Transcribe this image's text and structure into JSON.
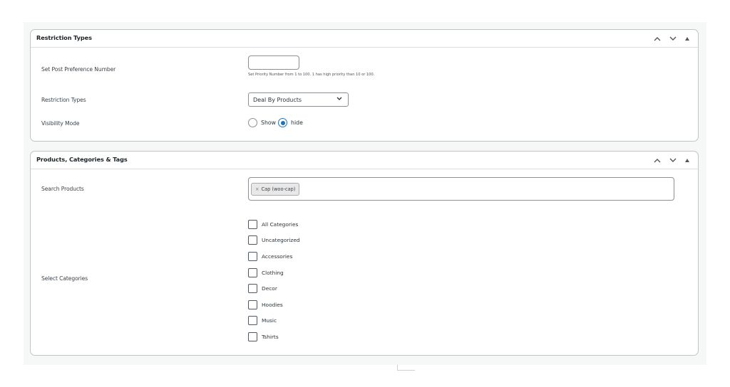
{
  "panels": {
    "restriction": {
      "title": "Restriction Types",
      "post_preference": {
        "label": "Set Post Preference Number",
        "value": "",
        "hint": "Set Priority Number from 1 to 100. 1 has high priority than 10 or 100."
      },
      "restriction_types": {
        "label": "Restriction Types",
        "selected": "Deal By Products"
      },
      "visibility": {
        "label": "Visibility Mode",
        "options": [
          "Show",
          "hide"
        ],
        "selected": "hide"
      }
    },
    "products": {
      "title": "Products, Categories & Tags",
      "search_products": {
        "label": "Search Products",
        "token_remove": "×",
        "tokens": [
          "Cap (woo-cap)"
        ]
      },
      "categories": {
        "label": "Select Categories",
        "items": [
          "All Categories",
          "Uncategorized",
          "Accessories",
          "Clothing",
          "Decor",
          "Hoodies",
          "Music",
          "Tshirts"
        ]
      }
    }
  },
  "icons": {
    "move_up": "chevron-up-icon",
    "move_down": "chevron-down-icon",
    "toggle": "triangle-up-icon"
  },
  "colors": {
    "accent": "#2271b1",
    "border": "#c3c4c7",
    "background": "#f6f7f7"
  }
}
